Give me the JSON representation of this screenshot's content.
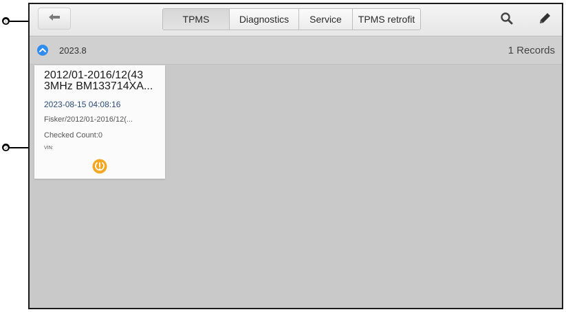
{
  "callouts": [
    "❶",
    "❷"
  ],
  "toolbar": {
    "back_icon": "back-arrow-icon",
    "tabs": [
      {
        "label": "TPMS",
        "active": true
      },
      {
        "label": "Diagnostics",
        "active": false
      },
      {
        "label": "Service",
        "active": false
      },
      {
        "label": "TPMS retrofit",
        "active": false
      }
    ],
    "search_icon": "search-icon",
    "edit_icon": "pencil-icon"
  },
  "group": {
    "title": "2023.8",
    "records": "1 Records",
    "accent": "#2f8cf0"
  },
  "card": {
    "title_line1": "2012/01-2016/12(43",
    "title_line2": "3MHz BM133714XA...",
    "date": "2023-08-15 04:08:16",
    "path": "Fisker/2012/01-2016/12(...",
    "checked_count": "Checked Count:0",
    "vin": "VIN:",
    "icon": "tpms-warning-icon",
    "icon_color": "#f5a623"
  }
}
